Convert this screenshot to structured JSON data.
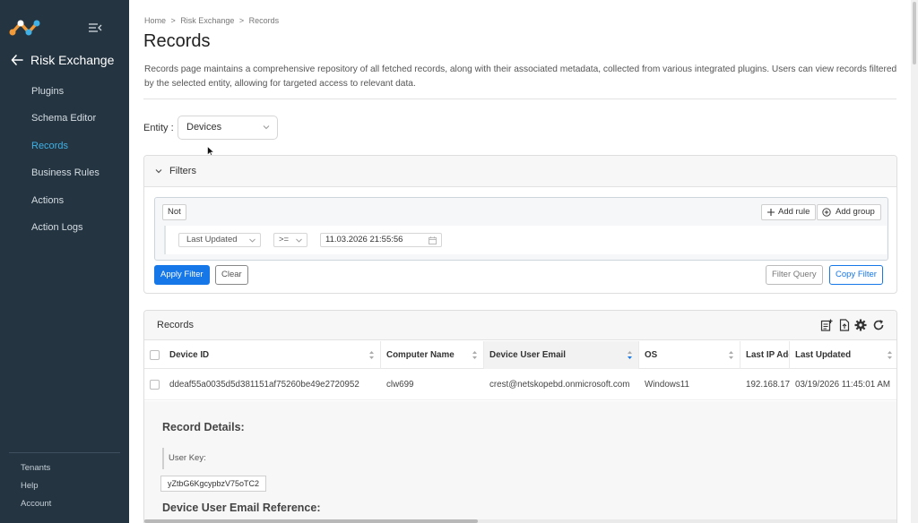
{
  "sidebar": {
    "app_title": "Risk Exchange",
    "items": [
      {
        "label": "Plugins"
      },
      {
        "label": "Schema Editor"
      },
      {
        "label": "Records",
        "active": true
      },
      {
        "label": "Business Rules"
      },
      {
        "label": "Actions"
      },
      {
        "label": "Action Logs"
      }
    ],
    "bottom": [
      {
        "label": "Tenants"
      },
      {
        "label": "Help"
      },
      {
        "label": "Account"
      }
    ],
    "accent_color": "#3fb1e6",
    "background_color": "#243441"
  },
  "breadcrumb": [
    "Home",
    ">",
    "Risk Exchange",
    ">",
    "Records"
  ],
  "page": {
    "title": "Records",
    "description": "Records page maintains a comprehensive repository of all fetched records, along with their associated metadata, collected from various integrated plugins. Users can view records filtered by the selected entity, allowing for targeted access to relevant data."
  },
  "entity": {
    "label": "Entity",
    "selected": "Devices"
  },
  "filters": {
    "title": "Filters",
    "not_label": "Not",
    "add_rule_label": "Add rule",
    "add_group_label": "Add group",
    "rule": {
      "field": "Last Updated",
      "operator": ">=",
      "value": "11.03.2026 21:55:56"
    },
    "apply_label": "Apply Filter",
    "clear_label": "Clear",
    "filter_query_label": "Filter Query",
    "copy_filter_label": "Copy Filter",
    "primary_color": "#1677e8"
  },
  "records": {
    "title": "Records",
    "columns": [
      "Device ID",
      "Computer Name",
      "Device User Email",
      "OS",
      "Last IP Address",
      "Last Updated"
    ],
    "rows": [
      {
        "device_id": "ddeaf55a0035d5d381151af75260be49e2720952",
        "computer_name": "clw699",
        "email": "crest@netskopebd.onmicrosoft.com",
        "os": "Windows11",
        "last_ip": "192.168.17.",
        "last_updated": "03/19/2026 11:45:01 AM"
      }
    ],
    "details": {
      "heading": "Record Details:",
      "user_key_label": "User Key:",
      "user_key_value": "yZtbG6KgcypbzV75oTC2",
      "email_ref_heading": "Device User Email Reference:"
    }
  },
  "icons": [
    "logo-icon",
    "collapse-menu-icon",
    "back-arrow-icon",
    "chevron-down-icon",
    "plus-icon",
    "plus-circle-icon",
    "calendar-icon",
    "export-list-icon",
    "export-file-icon",
    "gear-icon",
    "refresh-icon",
    "sort-icon"
  ]
}
